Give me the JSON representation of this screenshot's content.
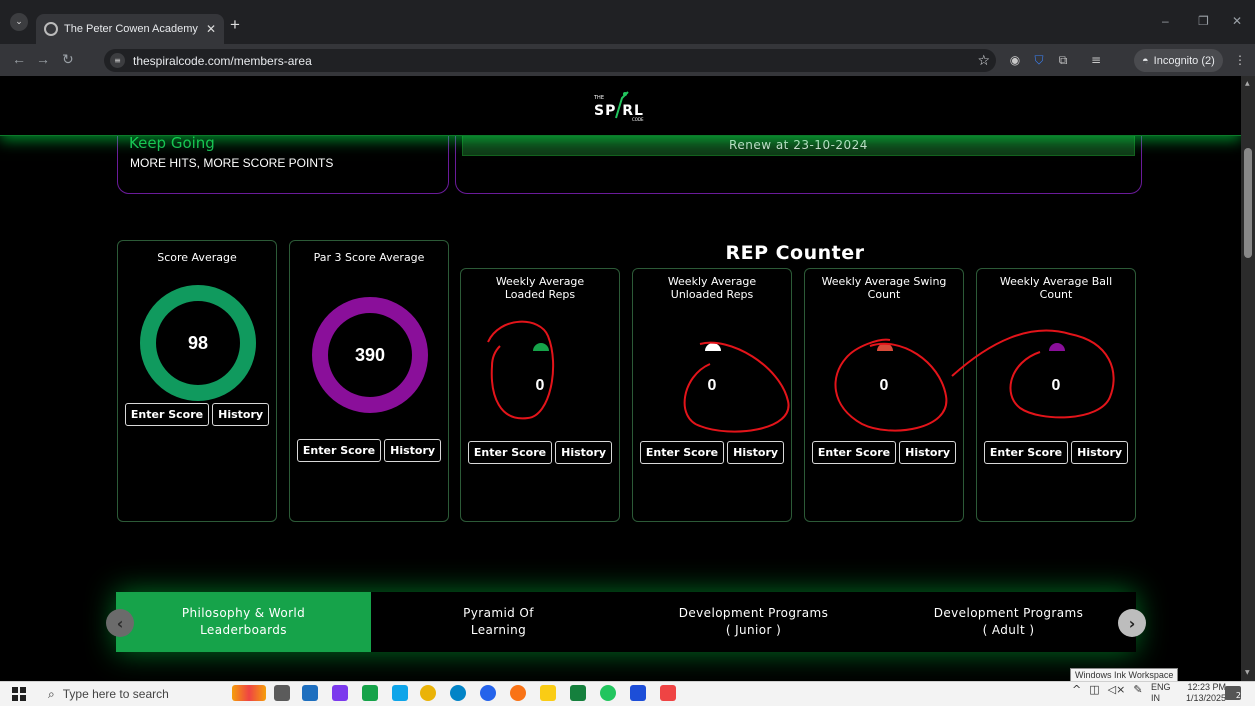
{
  "browser": {
    "tab_title": "The Peter Cowen Academy Onl...",
    "new_tab": "+",
    "url": "thespiralcode.com/members-area",
    "incognito_label": "Incognito (2)",
    "minimize": "–",
    "maximize": "❐",
    "close": "✕"
  },
  "site": {
    "logo_small": "THE",
    "logo_spiral": "SP RL",
    "logo_code": "CODE",
    "keep_title": "Keep Going",
    "keep_sub": "MORE HITS, MORE SCORE POINTS",
    "renew_text": "Renew at 23-10-2024",
    "rep_counter_title": "REP Counter"
  },
  "score_cards": [
    {
      "title": "Score Average",
      "value": "98",
      "color": "#109a5e"
    },
    {
      "title": "Par 3 Score Average",
      "value": "390",
      "color": "#8a0f9a"
    }
  ],
  "rep_cards": [
    {
      "title": "Weekly Average Loaded Reps",
      "value": "0",
      "arc_color": "#16a34a"
    },
    {
      "title": "Weekly Average Unloaded Reps",
      "value": "0",
      "arc_color": "#ffffff"
    },
    {
      "title": "Weekly Average Swing Count",
      "value": "0",
      "arc_color": "#d94b3a"
    },
    {
      "title": "Weekly Average Ball Count",
      "value": "0",
      "arc_color": "#8a0f9a"
    }
  ],
  "buttons": {
    "enter_score": "Enter Score",
    "history": "History"
  },
  "program_tabs": [
    {
      "line1": "Philosophy & World",
      "line2": "Leaderboards",
      "active": true
    },
    {
      "line1": "Pyramid Of",
      "line2": "Learning",
      "active": false
    },
    {
      "line1": "Development Programs",
      "line2": "( Junior )",
      "active": false
    },
    {
      "line1": "Development Programs",
      "line2": "( Adult )",
      "active": false
    }
  ],
  "tooltip": "Windows Ink Workspace",
  "taskbar": {
    "search_placeholder": "Type here to search",
    "lang_line1": "ENG",
    "lang_line2": "IN",
    "time": "12:23 PM",
    "date": "1/13/2025",
    "notification_count": "2"
  }
}
